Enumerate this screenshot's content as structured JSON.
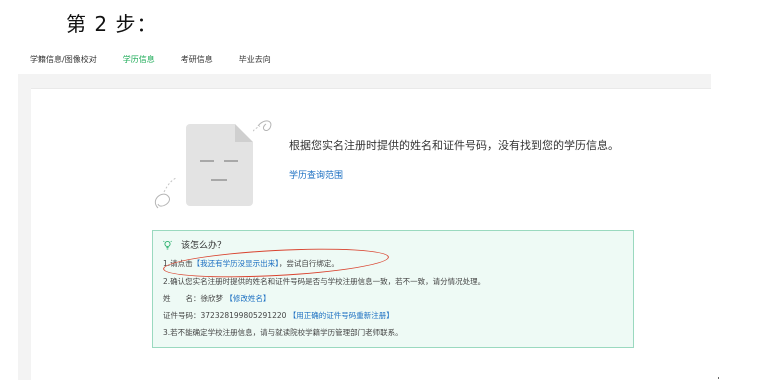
{
  "step_title": "第 2 步：",
  "tabs": [
    {
      "label": "学籍信息/图像校对",
      "active": false
    },
    {
      "label": "学历信息",
      "active": true
    },
    {
      "label": "考研信息",
      "active": false
    },
    {
      "label": "毕业去向",
      "active": false
    }
  ],
  "main": {
    "message": "根据您实名注册时提供的姓名和证件号码，没有找到您的学历信息。",
    "scope_link": "学历查询范围"
  },
  "help": {
    "title": "该怎么办？",
    "line1_prefix": "1.请点击",
    "line1_link": "【我还有学历没显示出来】",
    "line1_suffix": "，尝试自行绑定。",
    "line2": "2.确认您实名注册时提供的姓名和证件号码是否与学校注册信息一致，若不一致，请分情况处理。",
    "name_label": "姓　　名：",
    "name_value": "徐欣梦",
    "name_link": "【修改姓名】",
    "id_label": "证件号码：",
    "id_value": "372328199805291220",
    "id_link": "【用正确的证件号码重新注册】",
    "line3": "3.若不能确定学校注册信息，请与就读院校学籍学历管理部门老师联系。"
  },
  "colors": {
    "accent_green": "#1aaa55",
    "link_blue": "#1b6fc2",
    "help_bg": "#eefaf5",
    "help_border": "#9ad9bf",
    "annotation_red": "#d9432f"
  },
  "icons": [
    "sad-document-icon",
    "lightbulb-icon"
  ]
}
